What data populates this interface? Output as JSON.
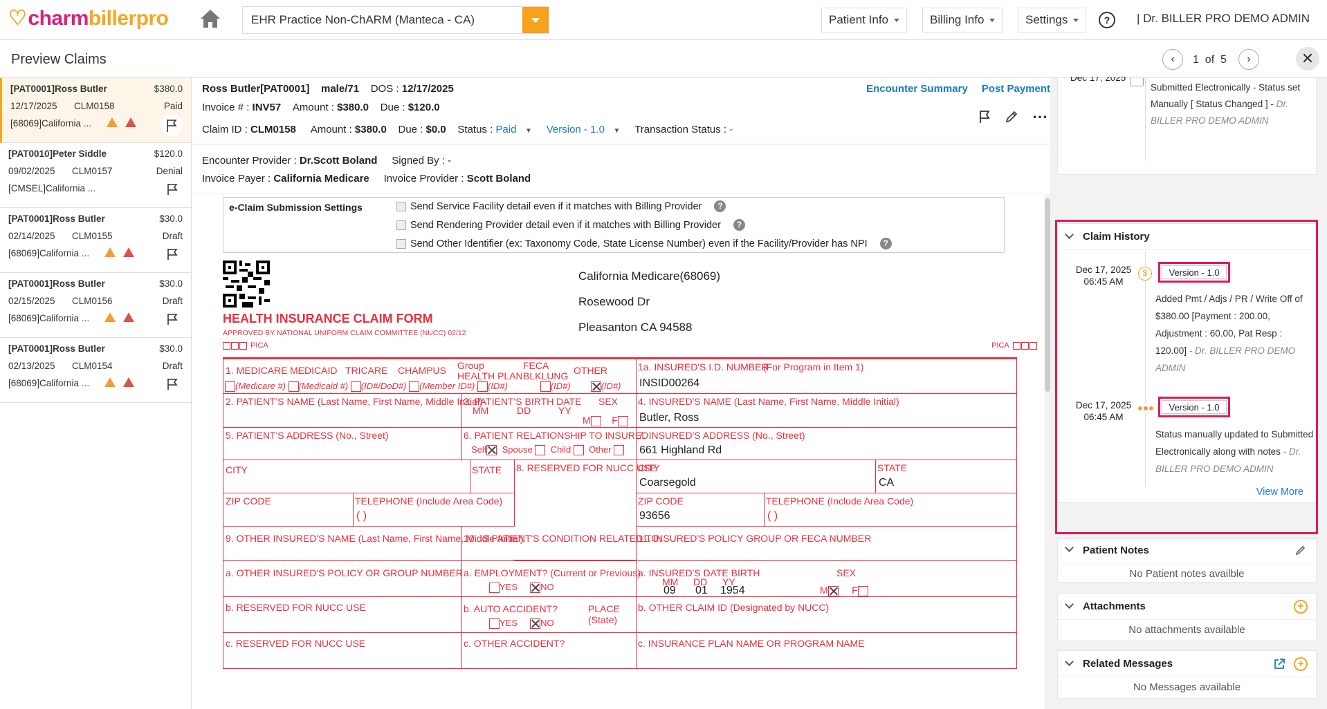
{
  "app": {
    "logo_charm": "charm",
    "logo_biller": "billerpro",
    "practice": "EHR Practice Non-ChARM (Manteca - CA)",
    "nav": [
      "Patient Info",
      "Billing Info",
      "Settings"
    ],
    "help": "?",
    "user": "|  Dr. BILLER PRO DEMO ADMIN"
  },
  "titlebar": {
    "title": "Preview Claims",
    "page_current": "1",
    "page_of": "of",
    "page_total": "5",
    "close": "✕"
  },
  "claims": [
    {
      "patient": "[PAT0001]Ross Butler",
      "amount": "$380.0",
      "date": "12/17/2025",
      "claim": "CLM0158",
      "status": "Paid",
      "payer": "[68069]California ...",
      "warnings": true
    },
    {
      "patient": "[PAT0010]Peter Siddle",
      "amount": "$120.0",
      "date": "09/02/2025",
      "claim": "CLM0157",
      "status": "Denial",
      "payer": "[CMSEL]California ...",
      "warnings": false
    },
    {
      "patient": "[PAT0001]Ross Butler",
      "amount": "$30.0",
      "date": "02/14/2025",
      "claim": "CLM0155",
      "status": "Draft",
      "payer": "[68069]California ...",
      "warnings": true
    },
    {
      "patient": "[PAT0001]Ross Butler",
      "amount": "$30.0",
      "date": "02/15/2025",
      "claim": "CLM0156",
      "status": "Draft",
      "payer": "[68069]California ...",
      "warnings": true
    },
    {
      "patient": "[PAT0001]Ross Butler",
      "amount": "$30.0",
      "date": "02/13/2025",
      "claim": "CLM0154",
      "status": "Draft",
      "payer": "[68069]California ...",
      "warnings": true
    }
  ],
  "header": {
    "patient": "Ross Butler[PAT0001]",
    "gender_age": "male/71",
    "dos_label": "DOS : ",
    "dos": "12/17/2025",
    "invoice_label": "Invoice # : ",
    "invoice": "INV57",
    "amount_label": "Amount : ",
    "amount": "$380.0",
    "due_label": "Due : ",
    "due": "$120.0",
    "claim_label": "Claim ID : ",
    "claim": "CLM0158",
    "c_amount": "$380.0",
    "c_due": "$0.0",
    "status_label": "Status : ",
    "status": "Paid",
    "version": "Version - 1.0",
    "tx_label": "Transaction Status : ",
    "tx": "-",
    "link_summary": "Encounter Summary",
    "link_payment": "Post Payment",
    "enc_provider_label": "Encounter Provider : ",
    "enc_provider": "Dr.Scott Boland",
    "signed_label": "Signed By : ",
    "signed": "-",
    "inv_payer_label": "Invoice Payer : ",
    "inv_payer": "California Medicare",
    "inv_provider_label": "Invoice Provider : ",
    "inv_provider": "Scott Boland"
  },
  "eclaim": {
    "label": "e-Claim Submission Settings",
    "options": [
      "Send Service Facility detail even if it matches with Billing Provider",
      "Send Rendering Provider detail even if it matches with Billing Provider",
      "Send Other Identifier (ex: Taxonomy Code, State License Number) even if the Facility/Provider has NPI"
    ]
  },
  "form": {
    "title": "HEALTH INSURANCE CLAIM FORM",
    "approved": "APPROVED BY NATIONAL UNIFORM CLAIM COMMITTEE (NUCC) 02/12",
    "pica": "PICA",
    "payer_name": "California Medicare(68069)",
    "payer_addr": "Rosewood Dr",
    "payer_city": "Pleasanton CA 94588",
    "box1_label": "1.  MEDICARE",
    "medicaid": "MEDICAID",
    "tricare": "TRICARE",
    "champus": "CHAMPUS",
    "group": "Group",
    "health_plan": "HEALTH PLAN",
    "feca": "FECA",
    "blklung": "BLKLUNG",
    "other": "OTHER",
    "medicare_id": "(Medicare #)",
    "medicaid_id": "(Medicaid #)",
    "dod_id": "(ID#/DoD#)",
    "member_id": "(Member ID#)",
    "id1": "(ID#)",
    "id2": "(ID#)",
    "id3": "(ID#)",
    "box1a": "1a. INSURED'S I.D. NUMBER",
    "box1a_note": "(For Program in Item 1)",
    "insured_id": "INSID00264",
    "box2": "2. PATIENT'S NAME (Last Name, First Name, Middle Initial)",
    "box3": "3. PATIENT'S BIRTH DATE",
    "mm": "MM",
    "dd": "DD",
    "yy": "YY",
    "sex": "SEX",
    "m": "M",
    "f": "F",
    "box4": "4. INSURED'S NAME (Last Name, First Name, Middle Initial)",
    "insured_name": "Butler, Ross",
    "box5": "5. PATIENT'S ADDRESS (No., Street)",
    "box6": "6. PATIENT RELATIONSHIP TO INSURED",
    "self": "Self",
    "spouse": "Spouse",
    "child": "Child",
    "other_rel": "Other",
    "box7": "7. INSURED'S ADDRESS (No., Street)",
    "insured_addr": "661 Highland Rd",
    "city": "CITY",
    "state": "STATE",
    "box8": "8. RESERVED FOR NUCC USE",
    "insured_city": "Coarsegold",
    "insured_state": "CA",
    "zip": "ZIP CODE",
    "phone": "TELEPHONE (Include Area Code)",
    "paren": "(        )",
    "insured_zip": "93656",
    "box9": "9. OTHER INSURED'S NAME (Last Name, First Name, Middle Initial)",
    "box10": "10. IS PATIENT'S CONDITION RELATED TO:",
    "box11": "11. INSURED'S POLICY GROUP OR FECA NUMBER",
    "box9a": "a. OTHER INSURED'S POLICY OR GROUP NUMBER",
    "box10a": "a. EMPLOYMENT? (Current or Previous)",
    "yes": "YES",
    "no": "NO",
    "box11a": "a. INSURED'S DATE BIRTH",
    "dob_mm": "09",
    "dob_dd": "01",
    "dob_yy": "1954",
    "box9b": "b. RESERVED FOR NUCC USE",
    "box10b": "b. AUTO ACCIDENT?",
    "place": "PLACE (State)",
    "box11b": "b. OTHER CLAIM ID (Designated by NUCC)",
    "box9c": "c. RESERVED FOR NUCC USE",
    "box10c": "c. OTHER ACCIDENT?",
    "box11c": "c. INSURANCE PLAN NAME OR PROGRAM NAME"
  },
  "right": {
    "top_date": "Dec 17, 2025",
    "top_note_1": "Submitted Electronically - Status",
    "top_note_2": "set Manually [ Status Changed ] - ",
    "top_note_by": "Dr.",
    "top_note_3": "BILLER PRO DEMO ADMIN",
    "claim_history": "Claim History",
    "entries": [
      {
        "date": "Dec 17, 2025",
        "time": "06:45 AM",
        "version": "Version - 1.0",
        "note": "Added Pmt / Adjs / PR / Write Off of $380.00 [Payment : 200.00, Adjustment : 60.00, Pat Resp : 120.00]",
        "by": " - Dr. BILLER PRO DEMO ADMIN"
      },
      {
        "date": "Dec 17, 2025",
        "time": "06:45 AM",
        "version": "Version - 1.0",
        "note": "Status manually updated to Submitted Electronically along with notes",
        "by": " - Dr. BILLER PRO DEMO ADMIN"
      }
    ],
    "view_more": "View More",
    "patient_notes": "Patient Notes",
    "patient_notes_empty": "No Patient notes availble",
    "attachments": "Attachments",
    "attachments_empty": "No attachments available",
    "related_messages": "Related Messages",
    "messages_empty": "No Messages available"
  }
}
